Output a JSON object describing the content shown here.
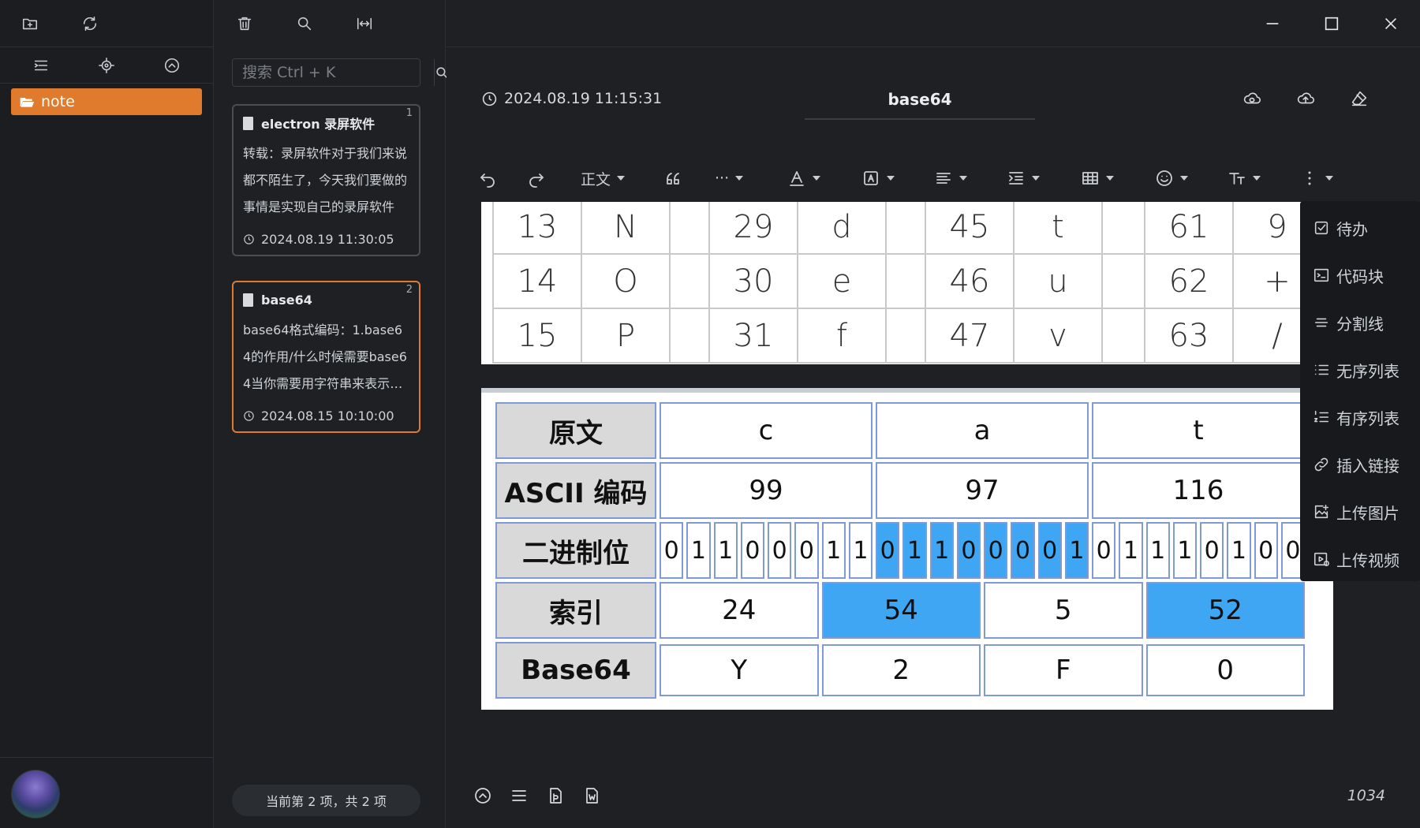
{
  "sidebar": {
    "folders": [
      {
        "label": "note"
      }
    ]
  },
  "note_list": {
    "search_placeholder": "搜索 Ctrl + K",
    "notes": [
      {
        "title": "electron 录屏软件",
        "index": "1",
        "preview": "转载：录屏软件对于我们来说都不陌生了，今天我们要做的事情是实现自己的录屏软件",
        "date": "2024.08.19 11:30:05"
      },
      {
        "title": "base64",
        "index": "2",
        "preview": "base64格式编码：1.base64的作用/什么时候需要base64当你需要用字符串来表示二进制数据",
        "date": "2024.08.15 10:10:00"
      }
    ],
    "pager": "当前第 2 项，共 2 项"
  },
  "editor": {
    "date": "2024.08.19 11:15:31",
    "title": "base64",
    "toolbar": {
      "paragraph_style": "正文",
      "more": "···"
    },
    "insert_menu": [
      "待办",
      "代码块",
      "分割线",
      "无序列表",
      "有序列表",
      "插入链接",
      "上传图片",
      "上传视频"
    ],
    "word_count": "1034"
  },
  "image_table_1": {
    "rows": [
      [
        "13",
        "N",
        "",
        "29",
        "d",
        "",
        "45",
        "t",
        "",
        "61",
        "9"
      ],
      [
        "14",
        "O",
        "",
        "30",
        "e",
        "",
        "46",
        "u",
        "",
        "62",
        "+"
      ],
      [
        "15",
        "P",
        "",
        "31",
        "f",
        "",
        "47",
        "v",
        "",
        "63",
        "/"
      ]
    ]
  },
  "image_table_2": {
    "headers": [
      "原文",
      "ASCII 编码",
      "二进制位",
      "索引",
      "Base64"
    ],
    "original": [
      "c",
      "a",
      "t"
    ],
    "ascii": [
      "99",
      "97",
      "116"
    ],
    "bits": [
      [
        "0",
        "1",
        "1",
        "0",
        "0",
        "0",
        "1",
        "1"
      ],
      [
        "0",
        "1",
        "1",
        "0",
        "0",
        "0",
        "0",
        "1"
      ],
      [
        "0",
        "1",
        "1",
        "1",
        "0",
        "1",
        "0",
        "0"
      ]
    ],
    "index": [
      "24",
      "54",
      "5",
      "52"
    ],
    "base64": [
      "Y",
      "2",
      "F",
      "0"
    ],
    "highlight_color": "#3ea6f2"
  }
}
